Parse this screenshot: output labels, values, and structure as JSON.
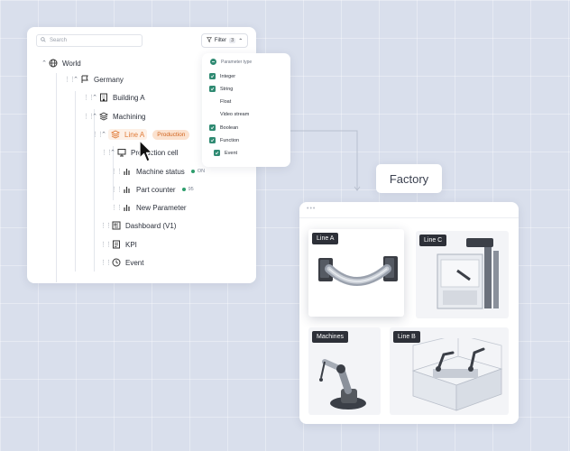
{
  "search": {
    "placeholder": "Search"
  },
  "filter": {
    "label": "Filter",
    "count": "3"
  },
  "tree": {
    "world": "World",
    "germany": "Germany",
    "building_a": "Building A",
    "machining": "Machining",
    "line_a": "Line A",
    "line_a_badge": "Production",
    "production_cell": "Production cell",
    "machine_status": {
      "label": "Machine status",
      "value": "ON"
    },
    "part_counter": {
      "label": "Part counter",
      "value": "95"
    },
    "new_parameter": "New Parameter",
    "dashboard": "Dashboard (V1)",
    "kpi": "KPI",
    "event": "Event"
  },
  "dropdown": {
    "header": "Parameter type",
    "items": [
      {
        "label": "Integer",
        "checked": true
      },
      {
        "label": "String",
        "checked": true
      },
      {
        "label": "Float",
        "checked": false
      },
      {
        "label": "Video stream",
        "checked": false
      },
      {
        "label": "Boolean",
        "checked": true
      },
      {
        "label": "Function",
        "checked": true
      },
      {
        "label": "Event",
        "checked": true
      }
    ]
  },
  "factory": {
    "title": "Factory",
    "cards": {
      "line_a": "Line A",
      "line_c": "Line C",
      "machines": "Machines",
      "line_b": "Line B"
    }
  },
  "colors": {
    "accent": "#e07b39",
    "check": "#2f8a72",
    "status": "#2e9d6c",
    "tag": "#2d3038"
  }
}
